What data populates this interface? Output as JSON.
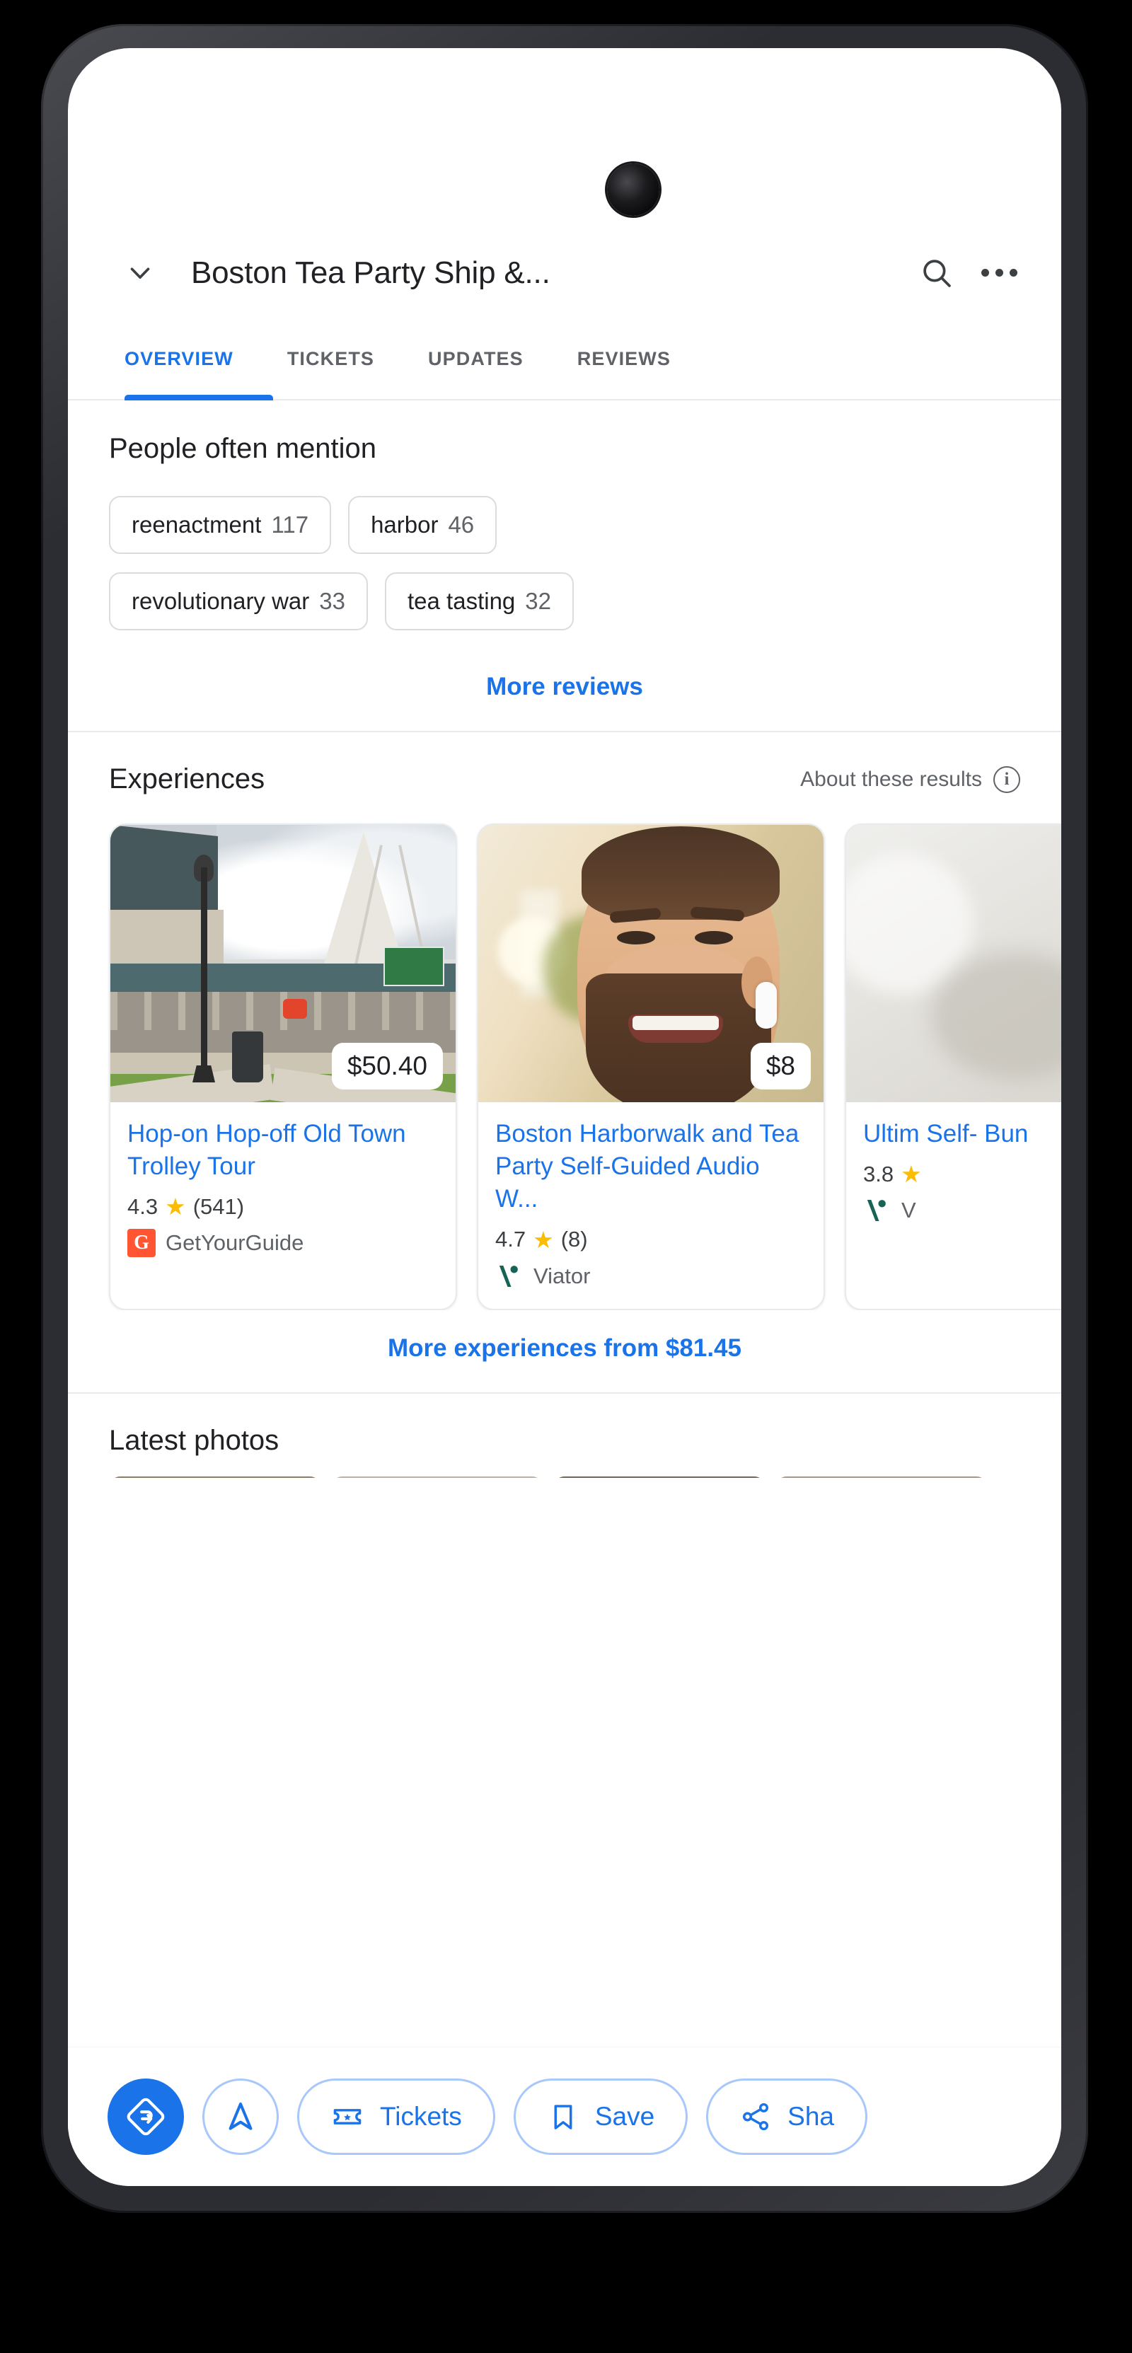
{
  "header": {
    "title": "Boston Tea Party Ship &...",
    "collapse_icon": "chevron-down-icon",
    "search_icon": "search-icon",
    "overflow_icon": "more-vertical-icon"
  },
  "tabs": [
    {
      "label": "OVERVIEW",
      "active": true
    },
    {
      "label": "TICKETS",
      "active": false
    },
    {
      "label": "UPDATES",
      "active": false
    },
    {
      "label": "REVIEWS",
      "active": false
    }
  ],
  "people_often_mention": {
    "title": "People often mention",
    "chips": [
      {
        "label": "reenactment",
        "count": "117"
      },
      {
        "label": "harbor",
        "count": "46"
      },
      {
        "label": "revolutionary war",
        "count": "33"
      },
      {
        "label": "tea tasting",
        "count": "32"
      }
    ],
    "more_link": "More reviews"
  },
  "experiences": {
    "title": "Experiences",
    "about_label": "About these results",
    "info_glyph": "i",
    "cards": [
      {
        "price": "$50.40",
        "title": "Hop-on Hop-off Old Town Trolley Tour",
        "rating": "4.3",
        "star": "★",
        "reviews": "(541)",
        "provider": "GetYourGuide",
        "provider_logo": "getyourguide-logo",
        "provider_logo_glyph": "G"
      },
      {
        "price": "$8",
        "title": "Boston Harborwalk and Tea Party Self-Guided Audio W...",
        "rating": "4.7",
        "star": "★",
        "reviews": "(8)",
        "provider": "Viator",
        "provider_logo": "viator-logo"
      },
      {
        "price": "",
        "title": "Ultim Self- Bun",
        "rating": "3.8",
        "star": "★",
        "reviews": "",
        "provider": "V",
        "provider_logo": "viator-logo"
      }
    ],
    "more_link": "More experiences from $81.45"
  },
  "latest_photos": {
    "title": "Latest photos"
  },
  "action_bar": {
    "directions_icon": "directions-icon",
    "navigation_icon": "navigation-arrow-icon",
    "tickets": {
      "label": "Tickets",
      "icon": "ticket-icon"
    },
    "save": {
      "label": "Save",
      "icon": "bookmark-icon"
    },
    "share": {
      "label": "Sha",
      "icon": "share-icon"
    }
  },
  "colors": {
    "accent": "#1a73e8",
    "star": "#fbbc04",
    "getyourguide": "#ff5533",
    "viator": "#176457",
    "text_primary": "#202124",
    "text_secondary": "#5f6368",
    "frame": "#2c2d33"
  }
}
